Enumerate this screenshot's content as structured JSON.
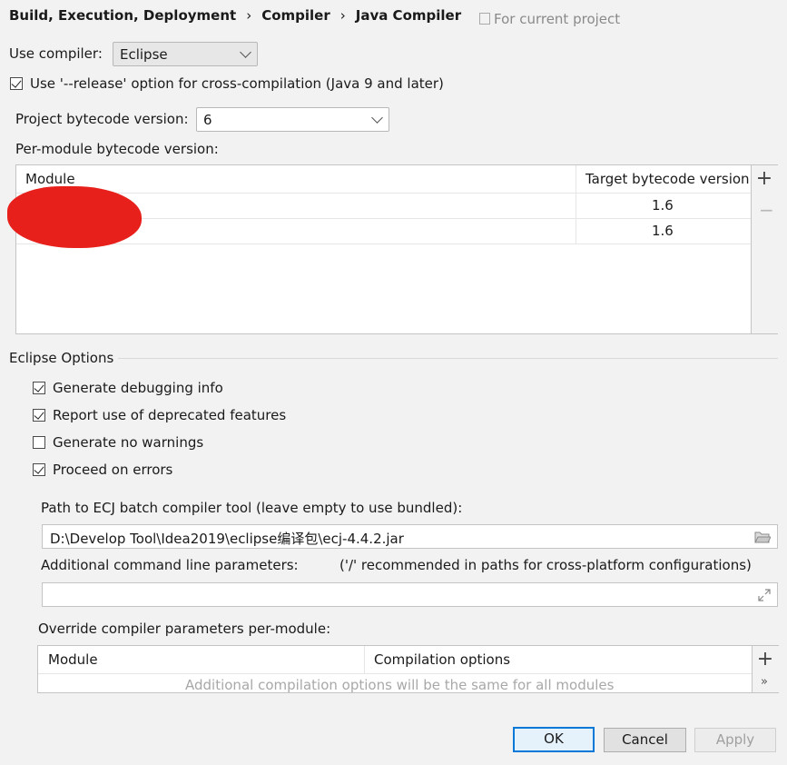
{
  "breadcrumb": {
    "items": [
      "Build, Execution, Deployment",
      "Compiler",
      "Java Compiler"
    ],
    "separator": "›"
  },
  "scope_note": "For current project",
  "use_compiler": {
    "label": "Use compiler:",
    "value": "Eclipse"
  },
  "release_option": {
    "label": "Use '--release' option for cross-compilation (Java 9 and later)",
    "checked": true
  },
  "project_bytecode": {
    "label": "Project bytecode version:",
    "value": "6"
  },
  "per_module": {
    "label": "Per-module bytecode version:",
    "columns": [
      "Module",
      "Target bytecode version"
    ],
    "rows": [
      {
        "module": "",
        "version": "1.6"
      },
      {
        "module": "",
        "version": "1.6"
      }
    ],
    "add_glyph": "+",
    "remove_glyph": "−"
  },
  "eclipse_options": {
    "title": "Eclipse Options",
    "checkboxes": [
      {
        "label": "Generate debugging info",
        "checked": true
      },
      {
        "label": "Report use of deprecated features",
        "checked": true
      },
      {
        "label": "Generate no warnings",
        "checked": false
      },
      {
        "label": "Proceed on errors",
        "checked": true
      }
    ]
  },
  "ecj_path": {
    "label": "Path to ECJ batch compiler tool (leave empty to use bundled):",
    "value": "D:\\Develop Tool\\Idea2019\\eclipse编译包\\ecj-4.4.2.jar"
  },
  "cmd_params": {
    "label": "Additional command line parameters:",
    "hint": "('/' recommended in paths for cross-platform configurations)",
    "value": ""
  },
  "override": {
    "label": "Override compiler parameters per-module:",
    "columns": [
      "Module",
      "Compilation options"
    ],
    "empty_text": "Additional compilation options will be the same for all modules",
    "add_glyph": "+",
    "more_glyph": "»"
  },
  "buttons": {
    "ok": "OK",
    "cancel": "Cancel",
    "apply": "Apply"
  },
  "colors": {
    "accent": "#0078d7",
    "redaction": "#e8201c"
  }
}
